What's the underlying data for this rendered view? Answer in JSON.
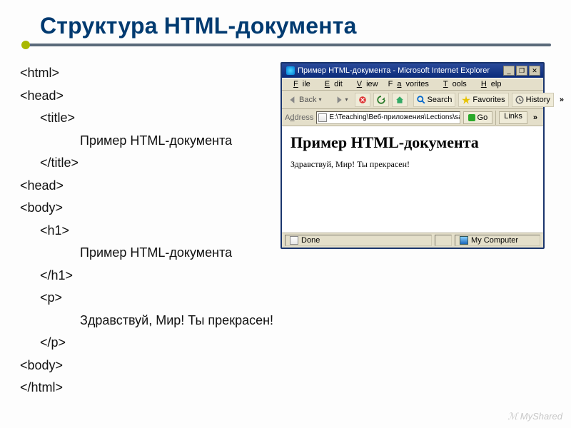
{
  "slide": {
    "title": "Структура HTML-документа"
  },
  "code": {
    "lines": [
      {
        "text": "<html>",
        "indent": 0
      },
      {
        "text": "<head>",
        "indent": 0
      },
      {
        "text": "<title>",
        "indent": 1
      },
      {
        "text": "Пример HTML-документа",
        "indent": 2
      },
      {
        "text": "</title>",
        "indent": 1
      },
      {
        "text": "<head>",
        "indent": 0
      },
      {
        "text": "<body>",
        "indent": 0
      },
      {
        "text": "<h1>",
        "indent": 1
      },
      {
        "text": "Пример HTML-документа",
        "indent": 2
      },
      {
        "text": "</h1>",
        "indent": 1
      },
      {
        "text": "<p>",
        "indent": 1
      },
      {
        "text": "Здравствуй, Мир! Ты прекрасен!",
        "indent": 2
      },
      {
        "text": "</p>",
        "indent": 1
      },
      {
        "text": "<body>",
        "indent": 0
      },
      {
        "text": "</html>",
        "indent": 0
      }
    ]
  },
  "browser": {
    "title": "Пример HTML-документа - Microsoft Internet Explorer",
    "window_buttons": {
      "min": "_",
      "max": "❐",
      "close": "✕"
    },
    "menu": [
      "File",
      "Edit",
      "View",
      "Favorites",
      "Tools",
      "Help"
    ],
    "toolbar": {
      "back": "Back",
      "search": "Search",
      "favorites": "Favorites",
      "history": "History",
      "chevron": "»"
    },
    "address": {
      "label": "Address",
      "value": "E:\\Teaching\\Веб-приложения\\Lections\\sample",
      "go": "Go",
      "links": "Links",
      "chevron": "»"
    },
    "page": {
      "h1": "Пример HTML-документа",
      "p": "Здравствуй, Мир! Ты прекрасен!"
    },
    "status": {
      "done": "Done",
      "zone": "My Computer"
    }
  },
  "watermark": "MyShared"
}
